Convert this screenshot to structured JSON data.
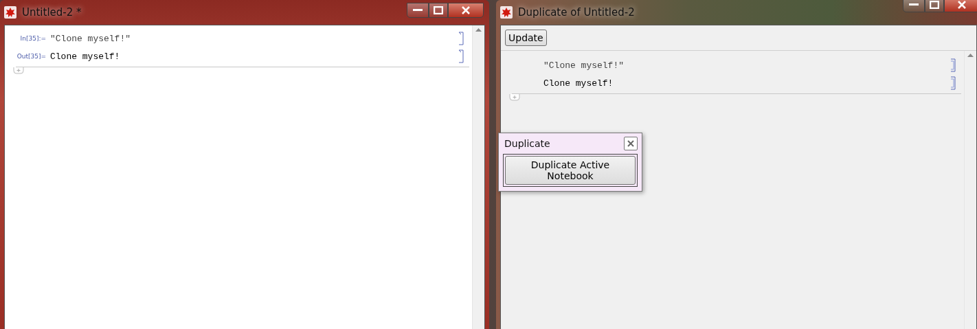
{
  "windows": [
    {
      "title": "Untitled-2 *",
      "kind": "notebook",
      "cells": [
        {
          "kind": "input",
          "label": "In[35]:=",
          "text": "\"Clone myself!\""
        },
        {
          "kind": "output",
          "label": "Out[35]=",
          "text": "Clone myself!"
        }
      ]
    },
    {
      "title": "Duplicate of Untitled-2",
      "kind": "viewer",
      "toolbar_button": "Update",
      "cells": [
        {
          "kind": "input",
          "text": "\"Clone myself!\""
        },
        {
          "kind": "output",
          "text": "Clone myself!"
        }
      ]
    }
  ],
  "palette": {
    "title": "Duplicate",
    "button": "Duplicate Active Notebook"
  }
}
